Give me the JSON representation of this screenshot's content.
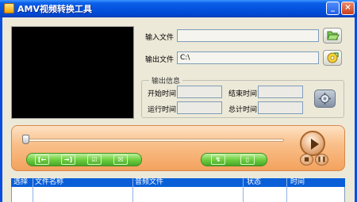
{
  "window": {
    "title": "AMV视频转换工具",
    "minimize_glyph": "_",
    "close_glyph": "×"
  },
  "input": {
    "label": "输入文件",
    "value": ""
  },
  "output": {
    "label": "输出文件",
    "value": "C:\\"
  },
  "output_info": {
    "title": "输出信息",
    "start_time_label": "开始时间",
    "start_time_value": "",
    "end_time_label": "结束时间",
    "end_time_value": "",
    "run_time_label": "运行时间",
    "run_time_value": "",
    "total_time_label": "总计时间",
    "total_time_value": ""
  },
  "playback": {
    "position_fraction": 0.0
  },
  "edit_buttons": [
    {
      "name": "mark-in-button",
      "glyph": "[←"
    },
    {
      "name": "mark-out-button",
      "glyph": "→]"
    },
    {
      "name": "check-button",
      "glyph": "☑"
    },
    {
      "name": "clear-button",
      "glyph": "☒"
    }
  ],
  "convert_buttons": [
    {
      "name": "convert-button",
      "glyph": "↯"
    },
    {
      "name": "stop-convert-button",
      "glyph": "▯"
    }
  ],
  "table": {
    "columns": [
      "选择",
      "文件名称",
      "音频文件",
      "状态",
      "时间"
    ]
  },
  "colors": {
    "titlebar": "#0553df",
    "panel_orange": "#f3a25e",
    "button_green": "#6fcf3f",
    "header_blue": "#0a5fd8"
  }
}
